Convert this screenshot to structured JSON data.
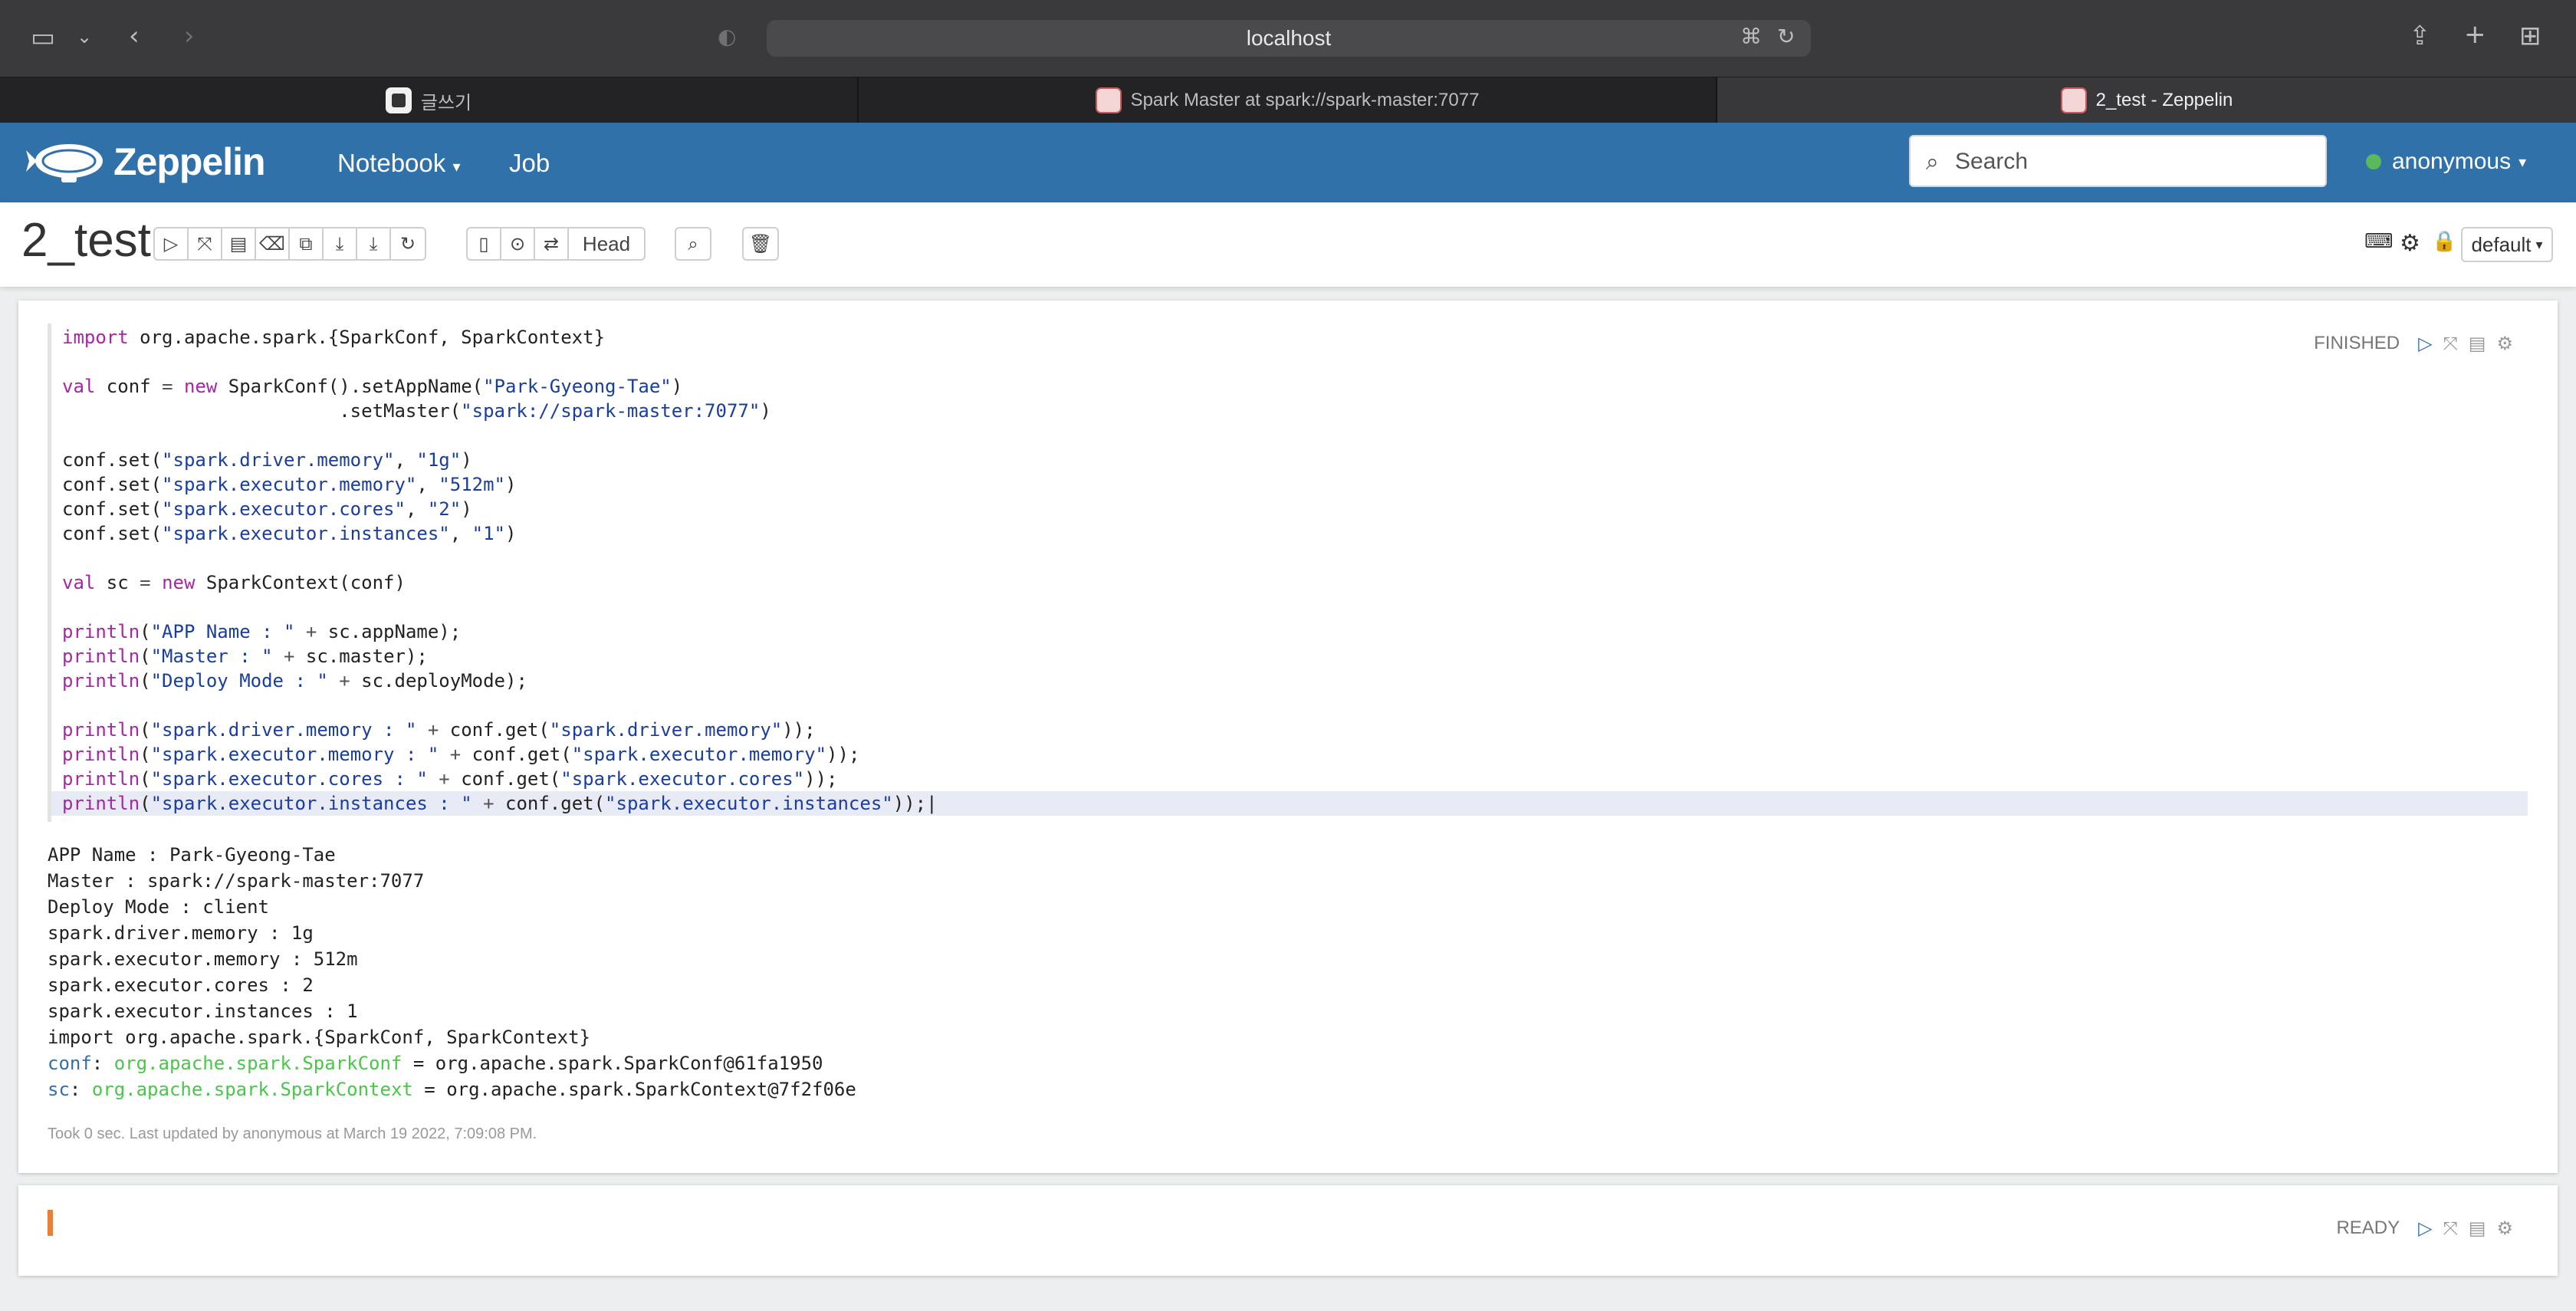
{
  "browser": {
    "url": "localhost",
    "tabs": [
      {
        "label": "글쓰기"
      },
      {
        "label": "Spark Master at spark://spark-master:7077"
      },
      {
        "label": "2_test - Zeppelin"
      }
    ]
  },
  "navbar": {
    "brand": "Zeppelin",
    "notebook_label": "Notebook",
    "job_label": "Job",
    "search_placeholder": "Search",
    "user": "anonymous"
  },
  "notebook": {
    "title": "2_test",
    "head_label": "Head",
    "interpreter": "default"
  },
  "paragraph1": {
    "status": "FINISHED",
    "output_lines": [
      "APP Name : Park-Gyeong-Tae",
      "Master : spark://spark-master:7077",
      "Deploy Mode : client",
      "spark.driver.memory : 1g",
      "spark.executor.memory : 512m",
      "spark.executor.cores : 2",
      "spark.executor.instances : 1",
      "import org.apache.spark.{SparkConf, SparkContext}"
    ],
    "conf_line": {
      "name": "conf",
      "type": "org.apache.spark.SparkConf",
      "value": " = org.apache.spark.SparkConf@61fa1950"
    },
    "sc_line": {
      "name": "sc",
      "type": "org.apache.spark.SparkContext",
      "value": " = org.apache.spark.SparkContext@7f2f06e"
    },
    "footer": "Took 0 sec. Last updated by anonymous at March 19 2022, 7:09:08 PM."
  },
  "paragraph2": {
    "status": "READY"
  }
}
